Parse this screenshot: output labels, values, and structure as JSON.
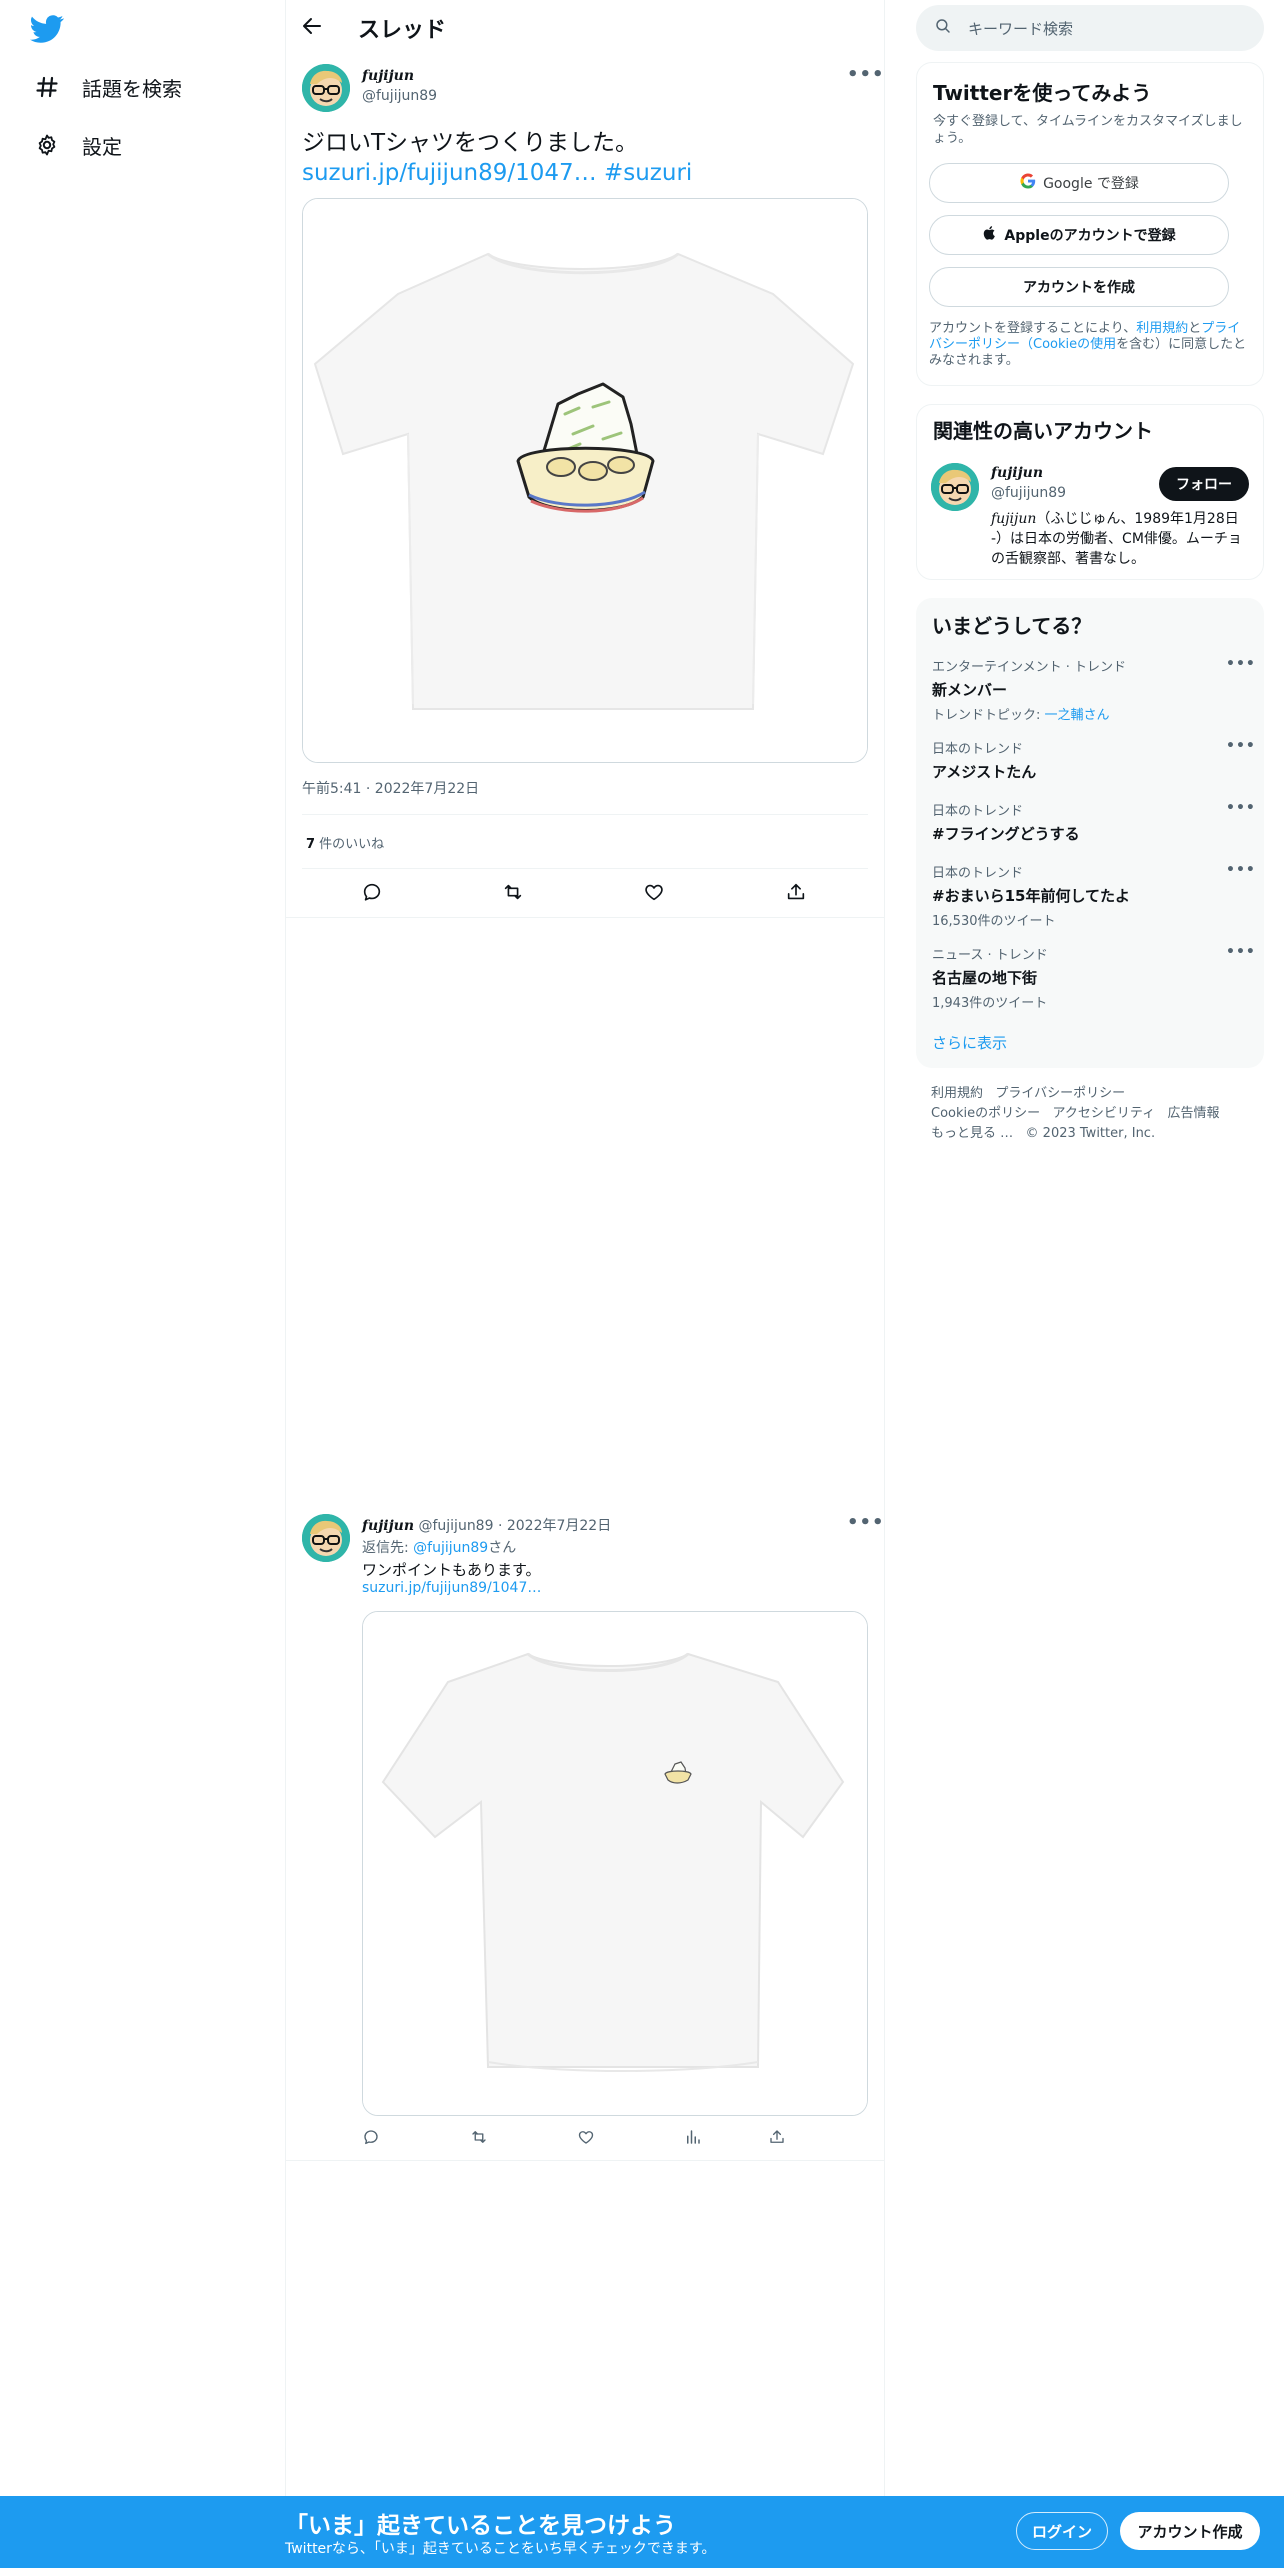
{
  "nav": {
    "logo_icon": "twitter-bird-icon",
    "items": [
      {
        "label": "話題を検索",
        "icon": "hashtag-icon"
      },
      {
        "label": "設定",
        "icon": "gear-icon"
      }
    ]
  },
  "header": {
    "title": "スレッド",
    "back_icon": "back-arrow-icon"
  },
  "main_tweet": {
    "name": "fujijun",
    "handle": "@fujijun89",
    "text": "ジロいTシャツをつくりました。",
    "link": "suzuri.jp/fujijun89/1047…",
    "hashtag": "#suzuri",
    "time": "午前5:41 · 2022年7月22日",
    "likes_count": "7",
    "likes_label": " 件のいいね"
  },
  "reply_tweet": {
    "name": "fujijun",
    "handle": "@fujijun89",
    "date": " · 2022年7月22日",
    "reply_prefix": "返信先: ",
    "reply_handle": "@fujijun89",
    "reply_suffix": "さん",
    "text": "ワンポイントもあります。",
    "link": "suzuri.jp/fujijun89/1047…"
  },
  "search": {
    "placeholder": "キーワード検索"
  },
  "signup_card": {
    "title": "Twitterを使ってみよう",
    "subtitle": "今すぐ登録して、タイムラインをカスタマイズしましょう。",
    "google_button": "Google で登録",
    "apple_button": "Appleのアカウントで登録",
    "create_button": "アカウントを作成",
    "legal_1": "アカウントを登録することにより、",
    "legal_terms": "利用規約",
    "legal_2": "と",
    "legal_privacy": "プライバシーポリシー（Cookieの使用",
    "legal_3": "を含む）に同意したとみなされます。"
  },
  "relevant_card": {
    "title": "関連性の高いアカウント",
    "name": "fujijun",
    "handle": "@fujijun89",
    "follow_button": "フォロー",
    "bio_name": "fujijun",
    "bio": "（ふじじゅん、1989年1月28日 -）は日本の労働者、CM俳優。ムーチョの舌観察部、著書なし。"
  },
  "trends": {
    "title": "いまどうしてる？",
    "items": [
      {
        "category": "エンターテインメント · トレンド",
        "name": "新メンバー",
        "sub_prefix": "トレンドトピック: ",
        "sub_link": "一之輔さん"
      },
      {
        "category": "日本のトレンド",
        "name": "アメジストたん"
      },
      {
        "category": "日本のトレンド",
        "name": "#フライングどうする"
      },
      {
        "category": "日本のトレンド",
        "name": "#おまいら15年前何してたよ",
        "sub": "16,530件のツイート"
      },
      {
        "category": "ニュース · トレンド",
        "name": "名古屋の地下街",
        "sub": "1,943件のツイート"
      }
    ],
    "show_more": "さらに表示"
  },
  "footer": {
    "line1": [
      "利用規約",
      "プライバシーポリシー"
    ],
    "line2": [
      "Cookieのポリシー",
      "アクセシビリティ",
      "広告情報"
    ],
    "more": "もっと見る …",
    "copyright": "© 2023 Twitter, Inc."
  },
  "bottom_bar": {
    "title": "「いま」起きていることを見つけよう",
    "subtitle": "Twitterなら、「いま」起きていることをいち早くチェックできます。",
    "login": "ログイン",
    "signup": "アカウント作成"
  },
  "colors": {
    "accent": "#1d9bf0",
    "text": "#0f1419",
    "muted": "#536471",
    "border": "#eff3f4"
  }
}
